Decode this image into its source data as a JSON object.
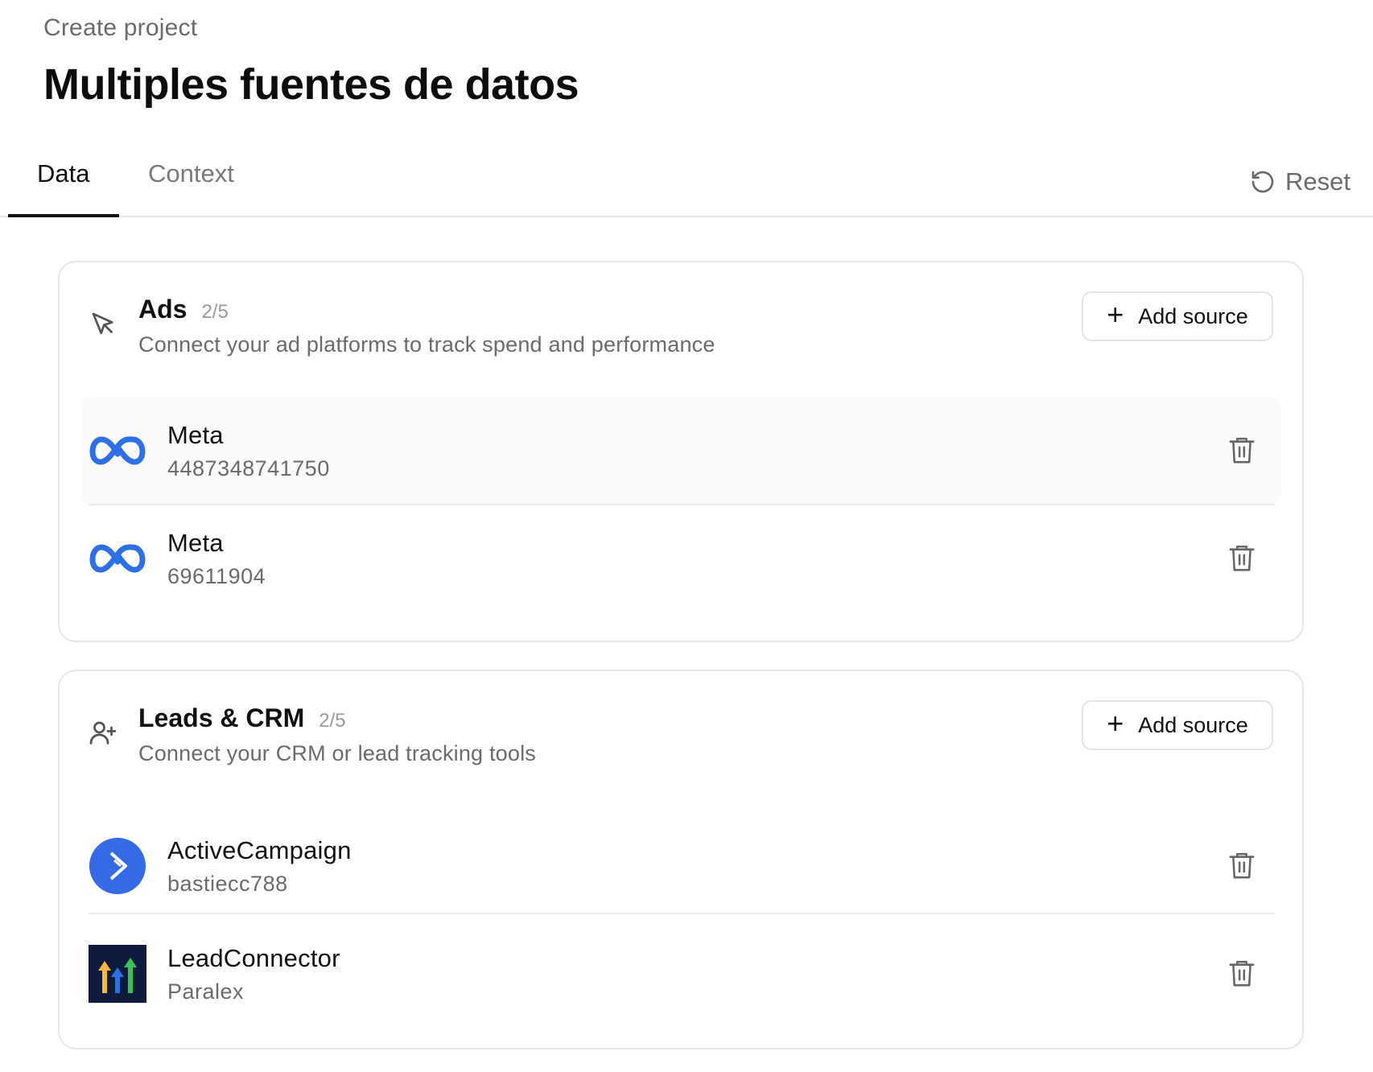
{
  "header": {
    "eyebrow": "Create project",
    "title": "Multiples fuentes de datos"
  },
  "tabs": [
    {
      "label": "Data",
      "active": true
    },
    {
      "label": "Context",
      "active": false
    }
  ],
  "reset_label": "Reset",
  "sections": [
    {
      "title": "Ads",
      "count": "2/5",
      "description": "Connect your ad platforms to track spend and performance",
      "add_label": "Add source",
      "icon": "cursor-arrow-icon",
      "sources": [
        {
          "name": "Meta",
          "detail": "4487348741750",
          "logo": "meta-logo"
        },
        {
          "name": "Meta",
          "detail": "69611904",
          "logo": "meta-logo"
        }
      ]
    },
    {
      "title": "Leads & CRM",
      "count": "2/5",
      "description": "Connect your CRM or lead tracking tools",
      "add_label": "Add source",
      "icon": "user-plus-icon",
      "sources": [
        {
          "name": "ActiveCampaign",
          "detail": "bastiecc788",
          "logo": "activecampaign-logo"
        },
        {
          "name": "LeadConnector",
          "detail": "Paralex",
          "logo": "leadconnector-logo"
        }
      ]
    }
  ],
  "colors": {
    "meta_blue": "#2f6fe4",
    "activecampaign_blue": "#356ae6",
    "leadconnector_bg": "#0e1b3d"
  }
}
